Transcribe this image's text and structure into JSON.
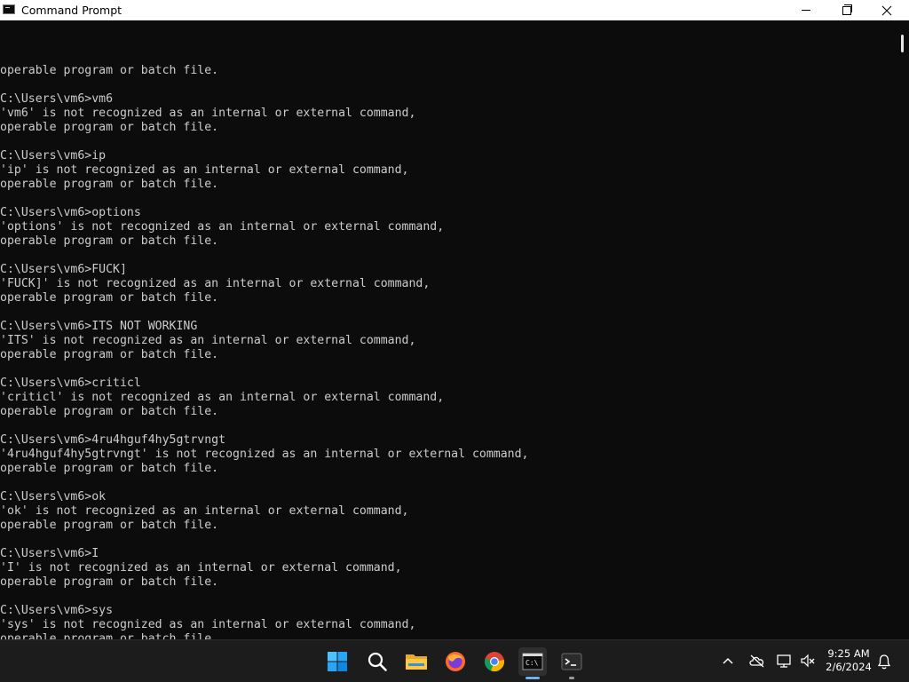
{
  "window": {
    "title": "Command Prompt",
    "controls": [
      "minimize",
      "maximize",
      "close"
    ]
  },
  "console": {
    "lines": [
      "operable program or batch file.",
      "",
      "C:\\Users\\vm6>vm6",
      "'vm6' is not recognized as an internal or external command,",
      "operable program or batch file.",
      "",
      "C:\\Users\\vm6>ip",
      "'ip' is not recognized as an internal or external command,",
      "operable program or batch file.",
      "",
      "C:\\Users\\vm6>options",
      "'options' is not recognized as an internal or external command,",
      "operable program or batch file.",
      "",
      "C:\\Users\\vm6>FUCK]",
      "'FUCK]' is not recognized as an internal or external command,",
      "operable program or batch file.",
      "",
      "C:\\Users\\vm6>ITS NOT WORKING",
      "'ITS' is not recognized as an internal or external command,",
      "operable program or batch file.",
      "",
      "C:\\Users\\vm6>criticl",
      "'criticl' is not recognized as an internal or external command,",
      "operable program or batch file.",
      "",
      "C:\\Users\\vm6>4ru4hguf4hy5gtrvngt",
      "'4ru4hguf4hy5gtrvngt' is not recognized as an internal or external command,",
      "operable program or batch file.",
      "",
      "C:\\Users\\vm6>ok",
      "'ok' is not recognized as an internal or external command,",
      "operable program or batch file.",
      "",
      "C:\\Users\\vm6>I",
      "'I' is not recognized as an internal or external command,",
      "operable program or batch file.",
      "",
      "C:\\Users\\vm6>sys",
      "'sys' is not recognized as an internal or external command,",
      "operable program or batch file.",
      ""
    ],
    "prompt": "C:\\Users\\vm6>",
    "current_input": "sys"
  },
  "taskbar": {
    "items": [
      {
        "name": "windows-start-icon",
        "active": false
      },
      {
        "name": "search-icon",
        "active": false
      },
      {
        "name": "file-explorer-icon",
        "active": false
      },
      {
        "name": "firefox-icon",
        "active": false
      },
      {
        "name": "chrome-icon",
        "active": false
      },
      {
        "name": "command-prompt-icon",
        "active": true
      },
      {
        "name": "terminal-icon",
        "active": false,
        "running": true
      }
    ],
    "tray": [
      "chevron-up-icon",
      "onedrive-offline-icon",
      "network-icon",
      "volume-muted-icon"
    ],
    "time": "9:25 AM",
    "date": "2/6/2024",
    "notification_icon": "bell-icon"
  },
  "colors": {
    "console_bg": "#0c0c0c",
    "console_text": "#cccccc",
    "titlebar_bg": "#ffffff",
    "taskbar_bg": "#1c1c1c",
    "active_indicator": "#6fb1ee"
  }
}
